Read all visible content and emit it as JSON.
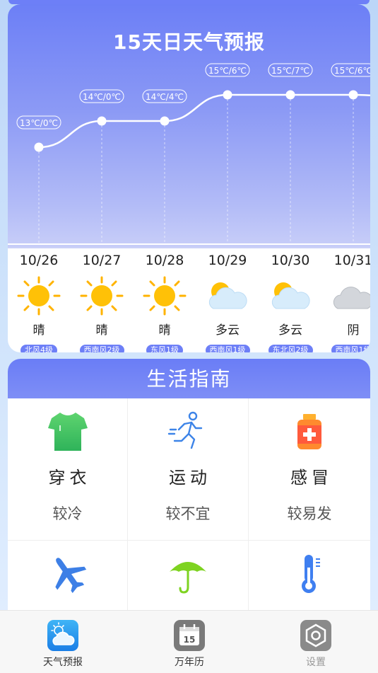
{
  "forecast": {
    "title": "15天日天气预报",
    "days": [
      {
        "date": "10/26",
        "condition": "晴",
        "wind": "北风4级",
        "temp": "13℃/0℃",
        "high": 13,
        "icon": "sun-icon"
      },
      {
        "date": "10/27",
        "condition": "晴",
        "wind": "西南风2级",
        "temp": "14℃/0℃",
        "high": 14,
        "icon": "sun-icon"
      },
      {
        "date": "10/28",
        "condition": "晴",
        "wind": "东风1级",
        "temp": "14℃/4℃",
        "high": 14,
        "icon": "sun-icon"
      },
      {
        "date": "10/29",
        "condition": "多云",
        "wind": "西南风1级",
        "temp": "15℃/6℃",
        "high": 15,
        "icon": "partly-cloudy-icon"
      },
      {
        "date": "10/30",
        "condition": "多云",
        "wind": "东北风2级",
        "temp": "15℃/7℃",
        "high": 15,
        "icon": "partly-cloudy-icon"
      },
      {
        "date": "10/31",
        "condition": "阴",
        "wind": "西南风1级",
        "temp": "15℃/6℃",
        "high": 15,
        "icon": "cloud-icon"
      }
    ]
  },
  "guide": {
    "title": "生活指南",
    "items": [
      {
        "name": "穿衣",
        "value": "较冷",
        "icon": "tshirt-icon"
      },
      {
        "name": "运动",
        "value": "较不宜",
        "icon": "running-icon"
      },
      {
        "name": "感冒",
        "value": "较易发",
        "icon": "medicine-icon"
      },
      {
        "name": "",
        "value": "",
        "icon": "airplane-icon"
      },
      {
        "name": "",
        "value": "",
        "icon": "umbrella-icon"
      },
      {
        "name": "",
        "value": "",
        "icon": "thermometer-icon"
      }
    ]
  },
  "nav": {
    "items": [
      {
        "label": "天气预报",
        "icon": "weather-icon",
        "active": true
      },
      {
        "label": "万年历",
        "icon": "calendar-icon",
        "calendar_day": "15",
        "active": false
      },
      {
        "label": "设置",
        "icon": "settings-icon",
        "active": false
      }
    ]
  },
  "colors": {
    "accent": "#6d7ff7",
    "active_nav": "#333333",
    "inactive_nav": "#999999"
  }
}
